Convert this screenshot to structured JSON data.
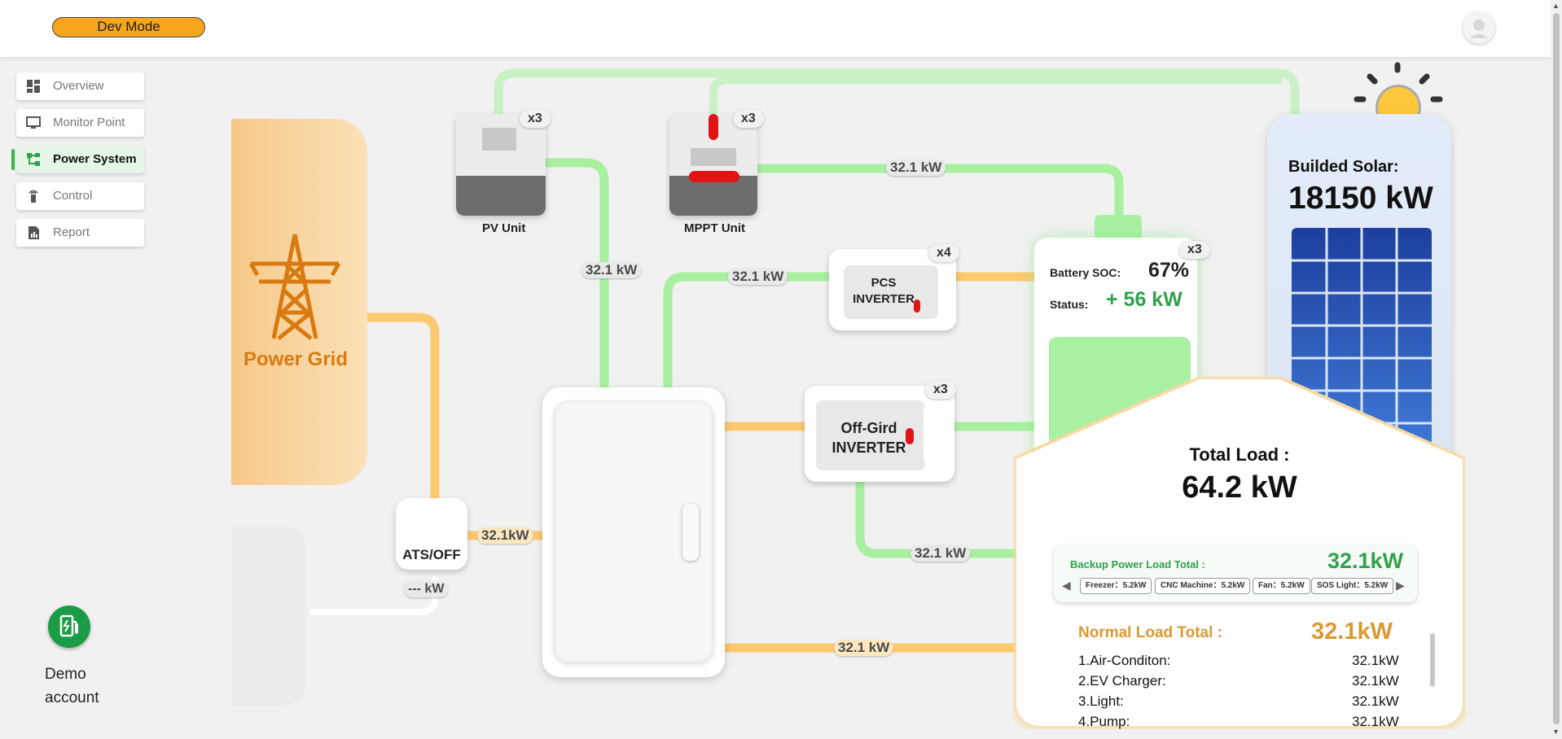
{
  "header": {
    "dev_mode_label": "Dev Mode"
  },
  "sidebar": {
    "items": [
      {
        "label": "Overview",
        "icon": "dashboard-icon"
      },
      {
        "label": "Monitor Point",
        "icon": "monitor-icon"
      },
      {
        "label": "Power System",
        "icon": "network-icon",
        "active": true
      },
      {
        "label": "Control",
        "icon": "remote-icon"
      },
      {
        "label": "Report",
        "icon": "report-icon"
      }
    ]
  },
  "account": {
    "label": "Demo account",
    "icon": "ev-charger-icon"
  },
  "diagram": {
    "power_grid": {
      "label": "Power Grid",
      "icon": "power-tower-icon"
    },
    "ats": {
      "label": "ATS/OFF",
      "value": "--- kW"
    },
    "pv_unit": {
      "label": "PV Unit",
      "count": "x3"
    },
    "mppt_unit": {
      "label": "MPPT Unit",
      "count": "x3"
    },
    "pcs_inverter": {
      "label_line1": "PCS",
      "label_line2": "INVERTER",
      "count": "x4"
    },
    "offgrid_inverter": {
      "label_line1": "Off-Gird",
      "label_line2": "INVERTER",
      "count": "x3"
    },
    "battery": {
      "count": "x3",
      "soc_label": "Battery SOC:",
      "soc_value": "67%",
      "status_label": "Status:",
      "status_value": "+ 56 kW"
    },
    "solar": {
      "title": "Builded Solar:",
      "value": "18150 kW"
    },
    "flows": {
      "pv_to_cabinet": "32.1 kW",
      "mppt_to_battery": "32.1 kW",
      "cabinet_to_pcs": "32.1 kW",
      "ats_to_cabinet": "32.1kW",
      "offgrid_to_backup": "32.1 kW",
      "cabinet_to_normal": "32.1 kW"
    },
    "load": {
      "total_title": "Total Load :",
      "total_value": "64.2 kW",
      "backup_title": "Backup Power Load Total :",
      "backup_value": "32.1kW",
      "backup_items": [
        "Freezer：5.2kW",
        "CNC Machine：5.2kW",
        "Fan：5.2kW",
        "SOS Light：5.2kW"
      ],
      "normal_title": "Normal Load Total :",
      "normal_value": "32.1kW",
      "normal_items": [
        {
          "name": "1.Air-Conditon:",
          "value": "32.1kW"
        },
        {
          "name": "2.EV Charger:",
          "value": "32.1kW"
        },
        {
          "name": "3.Light:",
          "value": "32.1kW"
        },
        {
          "name": "4.Pump:",
          "value": "32.1kW"
        }
      ]
    }
  },
  "colors": {
    "grid_orange": "#d97a10",
    "flow_green": "#a8f0a0",
    "flow_orange": "#fcc870",
    "accent_green": "#2fa24a",
    "normal_gold": "#d99a33"
  }
}
